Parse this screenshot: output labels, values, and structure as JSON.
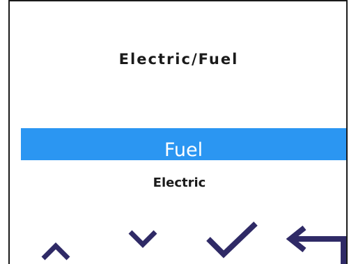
{
  "screen": {
    "title": "Electric/Fuel"
  },
  "options": {
    "selected": "Fuel",
    "items": [
      "Fuel",
      "Electric"
    ],
    "next": "Electric"
  },
  "buttons": {
    "up": "up-arrow-icon",
    "down": "down-arrow-icon",
    "confirm": "check-icon",
    "back": "back-arrow-icon"
  },
  "colors": {
    "highlight": "#2b96f2",
    "icon": "#2f2a66",
    "text": "#1a1a1a"
  }
}
